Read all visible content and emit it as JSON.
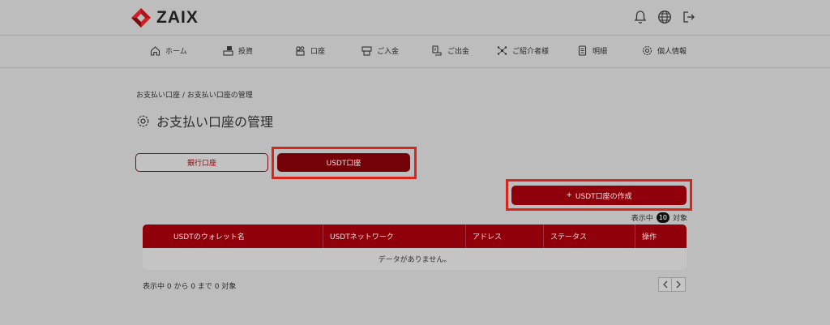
{
  "header": {
    "brand": "ZAIX",
    "icons": [
      "bell-icon",
      "globe-icon",
      "logout-icon"
    ]
  },
  "nav": {
    "items": [
      {
        "label": "ホーム",
        "icon": "home-icon"
      },
      {
        "label": "投資",
        "icon": "invest-icon"
      },
      {
        "label": "口座",
        "icon": "account-icon"
      },
      {
        "label": "ご入金",
        "icon": "deposit-icon"
      },
      {
        "label": "ご出金",
        "icon": "withdraw-icon"
      },
      {
        "label": "ご紹介者様",
        "icon": "referral-icon"
      },
      {
        "label": "明細",
        "icon": "statement-icon"
      },
      {
        "label": "個人情報",
        "icon": "settings-icon"
      }
    ]
  },
  "breadcrumb": {
    "text": "お支払い口座 / お支払い口座の管理"
  },
  "page": {
    "title": "お支払い口座の管理"
  },
  "tabs": {
    "bank": "銀行口座",
    "usdt": "USDT口座",
    "active": "usdt"
  },
  "actions": {
    "create_label": "USDT口座の作成"
  },
  "counter": {
    "prefix": "表示中",
    "count": "10",
    "suffix": "対象"
  },
  "table": {
    "columns": [
      "USDTのウォレット名",
      "USDTネットワーク",
      "アドレス",
      "ステータス",
      "操作"
    ],
    "empty_message": "データがありません。"
  },
  "footer": {
    "info": "表示中 0 から 0 まで 0 対象"
  },
  "colors": {
    "brand_red": "#90000a",
    "active_tab": "#740008",
    "highlight": "#d7261d"
  }
}
